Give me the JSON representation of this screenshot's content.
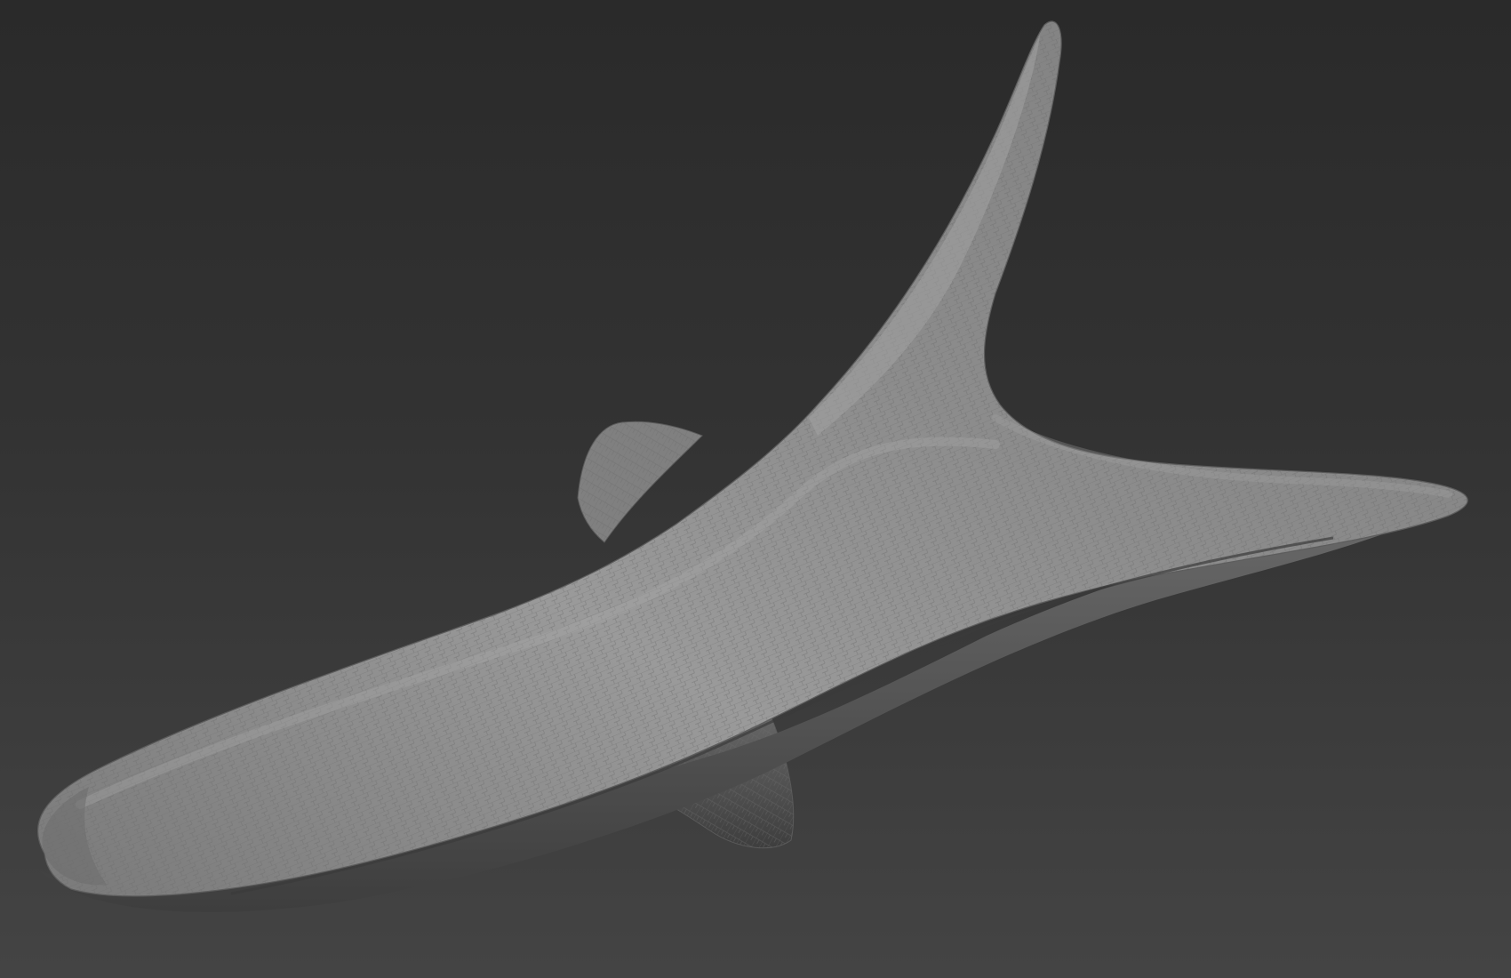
{
  "viewport": {
    "background_top": "#2a2a2a",
    "background_bottom": "#444444",
    "model": {
      "name_icon": "starfish-mesh",
      "surface_color": "#8a8a8a",
      "highlight_color": "#a8a8a8",
      "shadow_color": "#3a3a3a",
      "edge_color": "#5a5a5a"
    }
  }
}
